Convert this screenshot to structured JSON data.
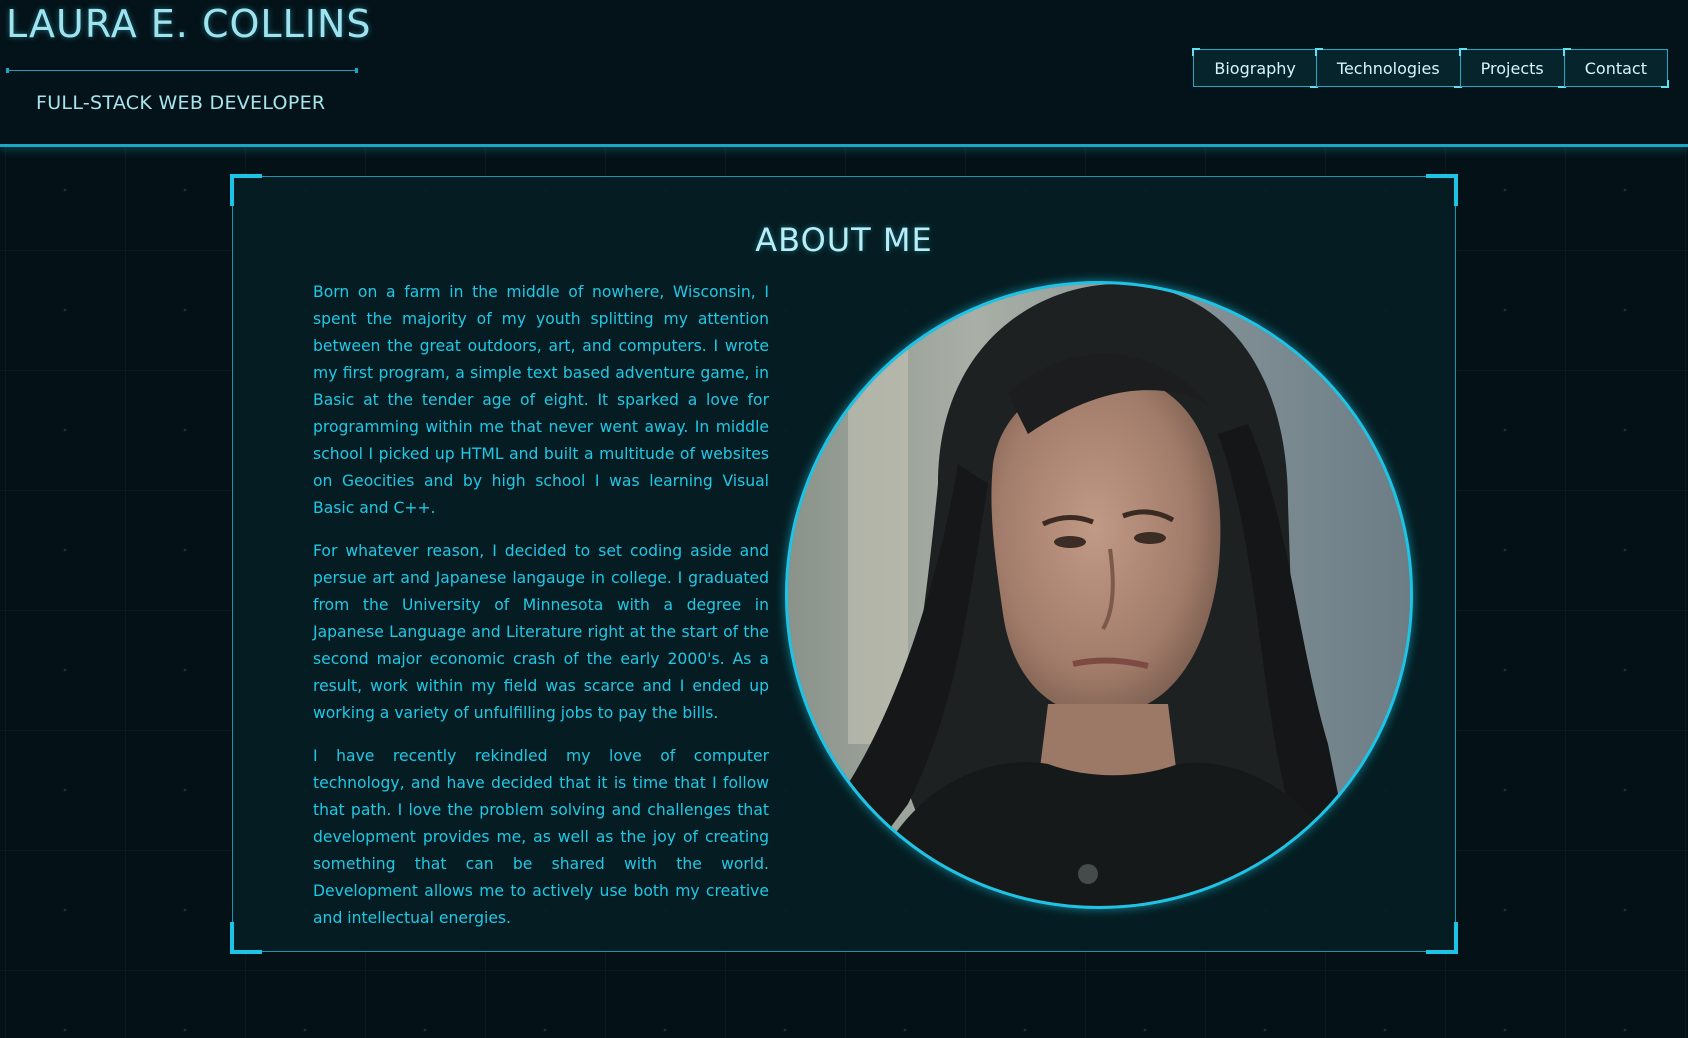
{
  "header": {
    "name": "LAURA E. COLLINS",
    "role": "FULL-STACK WEB DEVELOPER"
  },
  "nav": [
    {
      "label": "Biography"
    },
    {
      "label": "Technologies"
    },
    {
      "label": "Projects"
    },
    {
      "label": "Contact"
    }
  ],
  "about": {
    "title": "ABOUT ME",
    "paragraphs": [
      "Born on a farm in the middle of nowhere, Wisconsin, I spent the majority of my youth splitting my attention between the great outdoors, art, and computers. I wrote my first program, a simple text based adventure game, in Basic at the tender age of eight. It sparked a love for programming within me that never went away. In middle school I picked up HTML and built a multitude of websites on Geocities and by high school I was learning Visual Basic and C++.",
      "For whatever reason, I decided to set coding aside and persue art and Japanese langauge in college. I graduated from the University of Minnesota with a degree in Japanese Language and Literature right at the start of the second major economic crash of the early 2000's. As a result, work within my field was scarce and I ended up working a variety of unfulfilling jobs to pay the bills.",
      "I have recently rekindled my love of computer technology, and have decided that it is time that I follow that path. I love the problem solving and challenges that development provides me, as well as the joy of creating something that can be shared with the world. Development allows me to actively use both my creative and intellectual energies."
    ]
  },
  "colors": {
    "accent": "#1ec4e6",
    "text": "#20c8e6",
    "background": "#041116"
  }
}
